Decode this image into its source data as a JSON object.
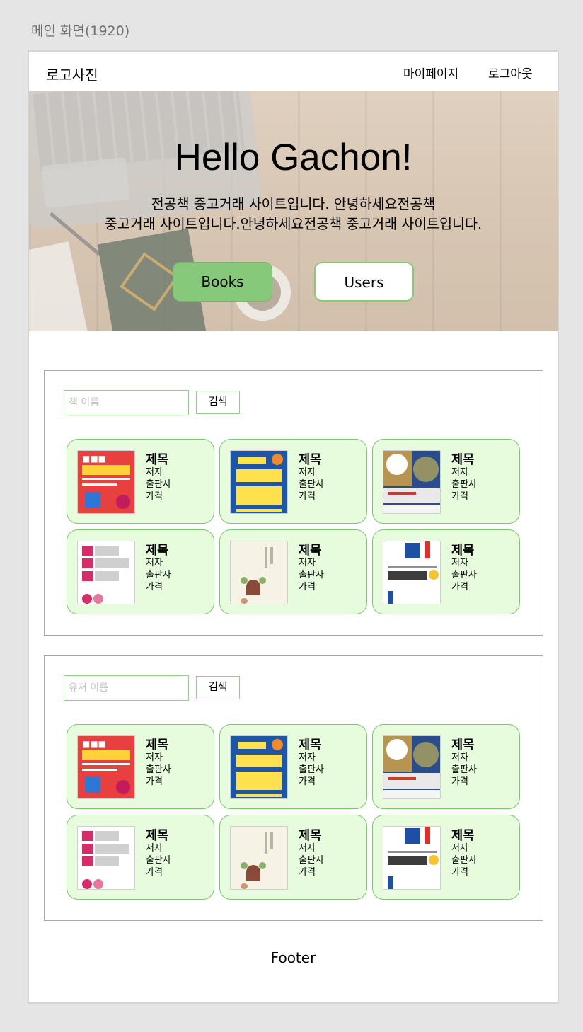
{
  "artboard_label": "메인 화면(1920)",
  "header": {
    "logo": "로고사진",
    "nav": {
      "mypage": "마이페이지",
      "logout": "로그아웃"
    }
  },
  "hero": {
    "title": "Hello Gachon!",
    "description_line1": "전공책 중고거래 사이트입니다. 안녕하세요전공책",
    "description_line2": "중고거래 사이트입니다.안녕하세요전공책 중고거래 사이트입니다.",
    "books_button": "Books",
    "users_button": "Users"
  },
  "book_search": {
    "placeholder": "책 이름",
    "button": "검색",
    "cards": [
      {
        "title": "제목",
        "author": "저자",
        "publisher": "출판사",
        "price": "가격",
        "cover": "hackers-tax-cover"
      },
      {
        "title": "제목",
        "author": "저자",
        "publisher": "출판사",
        "price": "가격",
        "cover": "practical-excel-cover"
      },
      {
        "title": "제목",
        "author": "저자",
        "publisher": "출판사",
        "price": "가격",
        "cover": "sinagong-cover"
      },
      {
        "title": "제목",
        "author": "저자",
        "publisher": "출판사",
        "price": "가격",
        "cover": "python-study-cover"
      },
      {
        "title": "제목",
        "author": "저자",
        "publisher": "출판사",
        "price": "가격",
        "cover": "minimal-illustration-cover"
      },
      {
        "title": "제목",
        "author": "저자",
        "publisher": "출판사",
        "price": "가격",
        "cover": "doit-python-cover"
      }
    ]
  },
  "user_search": {
    "placeholder": "유저 이름",
    "button": "검색",
    "cards": [
      {
        "title": "제목",
        "author": "저자",
        "publisher": "출판사",
        "price": "가격",
        "cover": "hackers-tax-cover"
      },
      {
        "title": "제목",
        "author": "저자",
        "publisher": "출판사",
        "price": "가격",
        "cover": "practical-excel-cover"
      },
      {
        "title": "제목",
        "author": "저자",
        "publisher": "출판사",
        "price": "가격",
        "cover": "sinagong-cover"
      },
      {
        "title": "제목",
        "author": "저자",
        "publisher": "출판사",
        "price": "가격",
        "cover": "python-study-cover"
      },
      {
        "title": "제목",
        "author": "저자",
        "publisher": "출판사",
        "price": "가격",
        "cover": "minimal-illustration-cover"
      },
      {
        "title": "제목",
        "author": "저자",
        "publisher": "출판사",
        "price": "가격",
        "cover": "doit-python-cover"
      }
    ]
  },
  "footer": {
    "text": "Footer"
  },
  "colors": {
    "accent_green": "#86c97b",
    "card_bg": "#e7fcdd",
    "card_border": "#7cc772"
  }
}
